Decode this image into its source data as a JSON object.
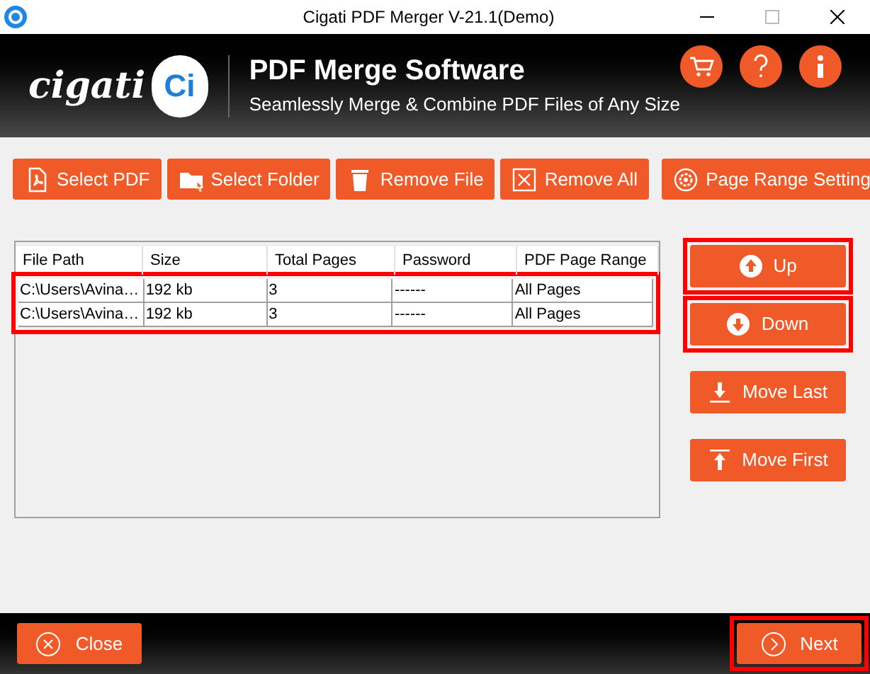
{
  "window": {
    "title": "Cigati PDF Merger V-21.1(Demo)"
  },
  "header": {
    "logo_text": "cigati",
    "logo_badge": "Ci",
    "title": "PDF Merge Software",
    "subtitle": "Seamlessly Merge & Combine PDF Files of Any Size"
  },
  "toolbar": [
    {
      "label": "Select PDF",
      "kind": "pdf"
    },
    {
      "label": "Select Folder",
      "kind": "folder"
    },
    {
      "label": "Remove File",
      "kind": "trash"
    },
    {
      "label": "Remove All",
      "kind": "removeall"
    },
    {
      "label": "Page Range Setting",
      "kind": "gear"
    }
  ],
  "table": {
    "columns": [
      "File Path",
      "Size",
      "Total Pages",
      "Password",
      "PDF Page Range"
    ],
    "rows_highlighted": true,
    "rows": [
      [
        "C:\\Users\\Avina…",
        "192 kb",
        "3",
        "------",
        "All Pages"
      ],
      [
        "C:\\Users\\Avina…",
        "192 kb",
        "3",
        "------",
        "All Pages"
      ]
    ]
  },
  "side_buttons": [
    {
      "label": "Up",
      "kind": "up",
      "highlighted": true
    },
    {
      "label": "Down",
      "kind": "down",
      "highlighted": true
    },
    {
      "label": "Move Last",
      "kind": "last",
      "highlighted": false
    },
    {
      "label": "Move First",
      "kind": "first",
      "highlighted": false
    }
  ],
  "footer": {
    "close": {
      "label": "Close",
      "highlighted": false
    },
    "next": {
      "label": "Next",
      "highlighted": true
    }
  }
}
